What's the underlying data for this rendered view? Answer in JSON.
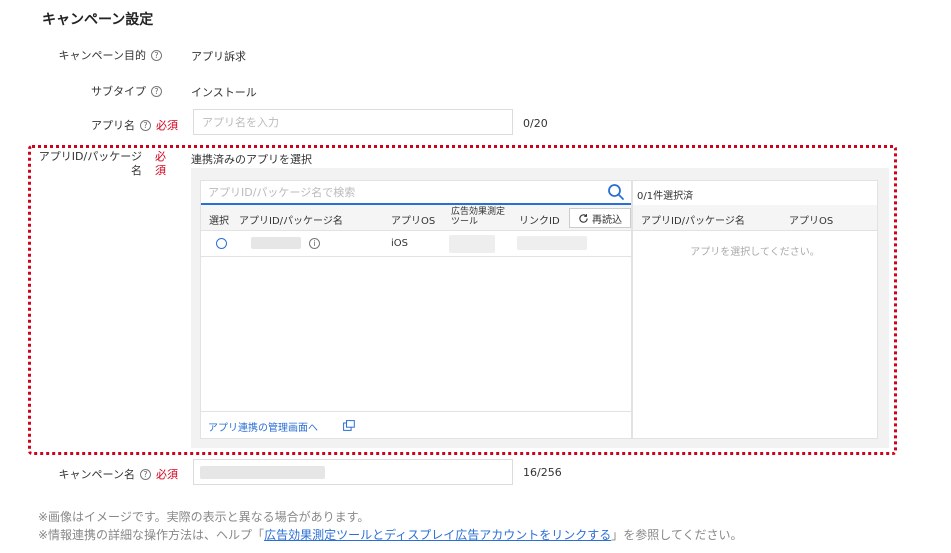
{
  "section_title": "キャンペーン設定",
  "objective": {
    "label": "キャンペーン目的",
    "value": "アプリ訴求"
  },
  "subtype": {
    "label": "サブタイプ",
    "value": "インストール"
  },
  "app_name": {
    "label": "アプリ名",
    "required": "必須",
    "placeholder": "アプリ名を入力",
    "counter": "0/20"
  },
  "app_id": {
    "label": "アプリID/パッケージ名",
    "required": "必須",
    "sub_label": "連携済みのアプリを選択",
    "search_placeholder": "アプリID/パッケージ名で検索",
    "columns": {
      "select": "選択",
      "app_id": "アプリID/パッケージ名",
      "os": "アプリOS",
      "tool": "広告効果測定ツール",
      "link_id": "リンクID"
    },
    "reload_label": "再読込",
    "rows": [
      {
        "os": "iOS"
      }
    ],
    "manage_link": "アプリ連携の管理画面へ",
    "selected_count": "0/1件選択済",
    "right_columns": {
      "app_id": "アプリID/パッケージ名",
      "os": "アプリOS"
    },
    "empty_text": "アプリを選択してください。"
  },
  "campaign_name": {
    "label": "キャンペーン名",
    "required": "必須",
    "counter": "16/256"
  },
  "notes": {
    "line1": "※画像はイメージです。実際の表示と異なる場合があります。",
    "line2_prefix": "※情報連携の詳細な操作方法は、ヘルプ「",
    "line2_link": "広告効果測定ツールとディスプレイ広告アカウントをリンクする",
    "line2_suffix": "」を参照してください。"
  },
  "colors": {
    "accent": "#2a6fd6",
    "required": "#d0021b",
    "highlight_border": "#d0021b"
  }
}
